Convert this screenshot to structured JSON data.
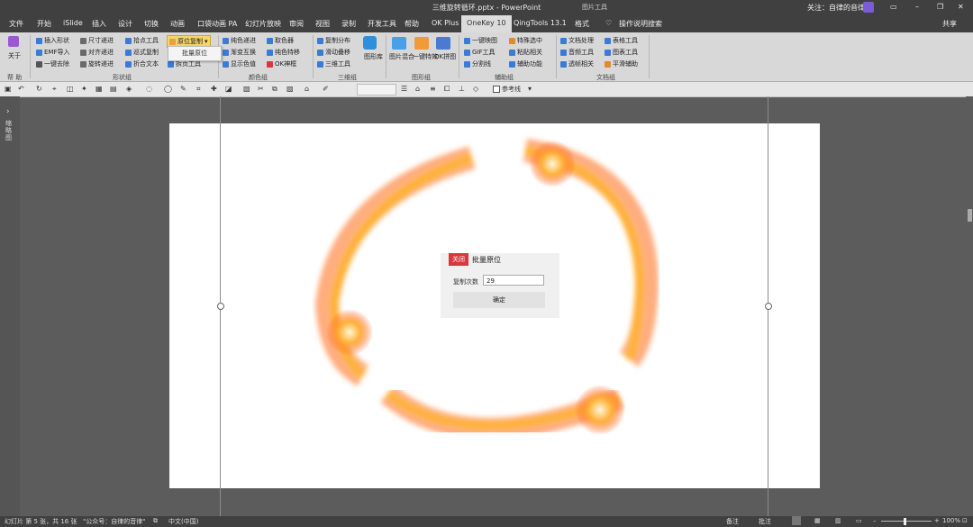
{
  "window": {
    "title": "三维旋转循环.pptx  -  PowerPoint",
    "context_tab": "图片工具",
    "follow_text": "关注：自律的音律",
    "share": "共享"
  },
  "tabs": [
    "文件",
    "开始",
    "iSlide",
    "插入",
    "设计",
    "切换",
    "动画",
    "口袋动画 PA",
    "幻灯片放映",
    "审阅",
    "视图",
    "录制",
    "开发工具",
    "帮助",
    "OK Plus",
    "OneKey 10",
    "QingTools 13.1",
    "格式"
  ],
  "active_tab": "OneKey 10",
  "search": "操作说明搜索",
  "ribbon": {
    "about": "关于",
    "groups": [
      "帮 助",
      "形状组",
      "颜色组",
      "三维组",
      "图形组",
      "辅助组",
      "文档组"
    ],
    "shape_col1": [
      "插入形状",
      "EMF导入",
      "一键去除"
    ],
    "shape_col2": [
      "尺寸递进",
      "对齐递进",
      "旋转递进"
    ],
    "shape_col3": [
      "拾点工具",
      "巡式复制",
      "折合文本"
    ],
    "shape_col4": [
      "原位复制",
      "批量原位",
      "拆页工具"
    ],
    "color_col1": [
      "纯色递进",
      "渐变互换",
      "显示色值"
    ],
    "color_col2": [
      "取色器",
      "纯色特移",
      "OK神框"
    ],
    "three_col": [
      "复制分布",
      "滑动叠移",
      "三维工具"
    ],
    "three_big": "图形库",
    "graphic_items": [
      "图片混合",
      "一键特效",
      "OK拼图"
    ],
    "aux_col1": [
      "一键映图",
      "GIF工具",
      "分割线"
    ],
    "aux_col2": [
      "特殊选中",
      "粘贴相关",
      "辅助功能"
    ],
    "doc_col1": [
      "文档处理",
      "音频工具",
      "透帧相关"
    ],
    "doc_col2": [
      "表格工具",
      "图表工具",
      "平滑辅助"
    ],
    "dropdown_item": "批量原位"
  },
  "qat": {
    "ref_line": "参考线"
  },
  "left_panel_label": "缩略图",
  "dialog": {
    "close": "关闭",
    "title": "批量原位",
    "label": "复制次数",
    "value": "29",
    "ok": "确定"
  },
  "status": {
    "slide_info": "幻灯片 第 5 张，共 16 张",
    "account": "\"公众号：自律的音律\"",
    "language": "中文(中国)",
    "notes": "备注",
    "comments": "批注",
    "zoom": "100%"
  },
  "colors": {
    "dialog_close": "#d9363e",
    "flame_core": "#ff7a1a"
  }
}
